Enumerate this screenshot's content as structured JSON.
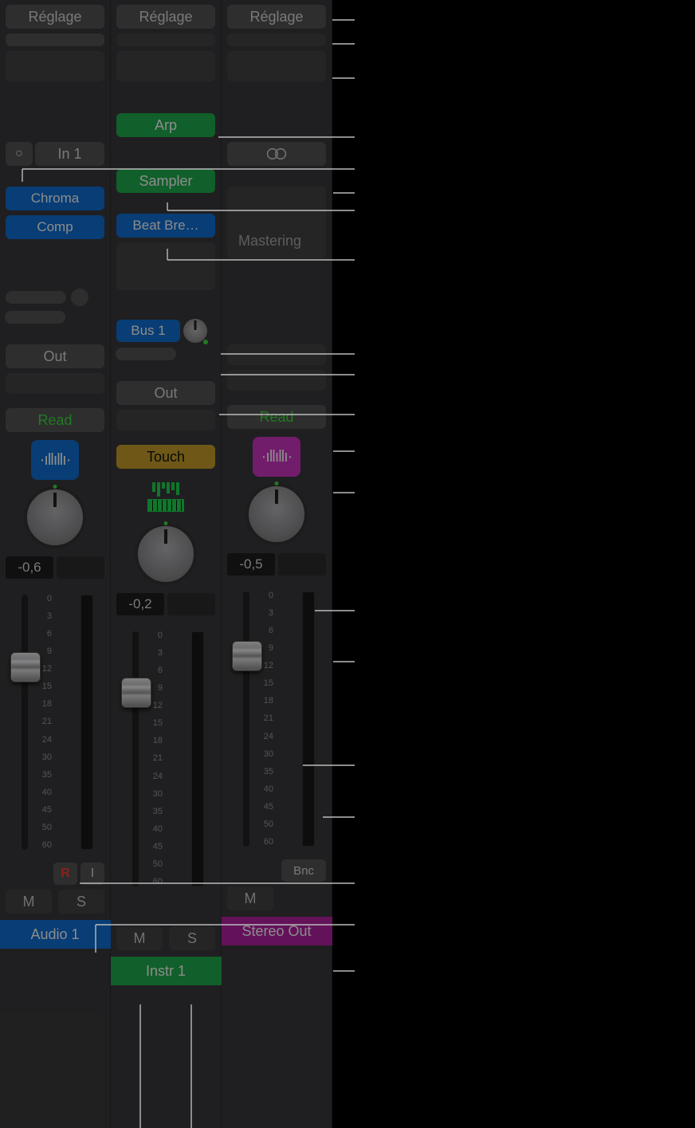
{
  "settings_label": "Réglage",
  "strips": [
    {
      "name": "Audio 1",
      "color": "blue",
      "input_mon": "○",
      "input": "In 1",
      "fx": [
        "Chroma",
        "Comp"
      ],
      "out": "Out",
      "automation": "Read",
      "automation_style": "readgreen",
      "icon": "audio",
      "db": "-0,6",
      "rec": "R",
      "inputmon_btn": "I",
      "mute": "M",
      "solo": "S"
    },
    {
      "name": "Instr 1",
      "color": "green",
      "midi_fx": "Arp",
      "instrument": "Sampler",
      "fx": [
        "Beat Bre…"
      ],
      "send": "Bus 1",
      "out": "Out",
      "automation": "Touch",
      "automation_style": "yellow",
      "icon": "instrument",
      "db": "-0,2",
      "mute": "M",
      "solo": "S"
    },
    {
      "name": "Stereo Out",
      "color": "mag",
      "mastering": "Mastering",
      "automation": "Read",
      "automation_style": "readgreen",
      "icon": "audio-mag",
      "db": "-0,5",
      "bnc": "Bnc",
      "mute": "M"
    }
  ],
  "scale": [
    "0",
    "3",
    "6",
    "9",
    "12",
    "15",
    "18",
    "21",
    "24",
    "30",
    "35",
    "40",
    "45",
    "50",
    "60"
  ]
}
